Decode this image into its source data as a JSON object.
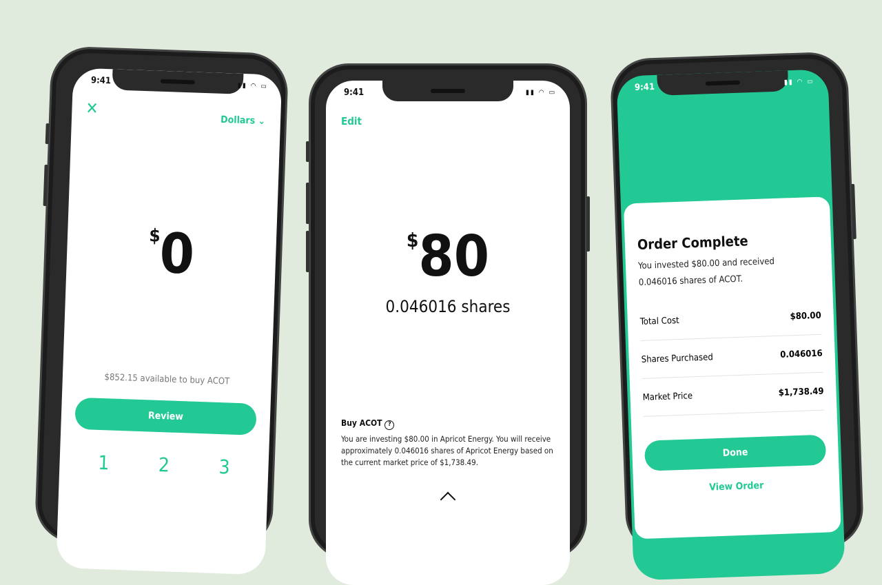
{
  "colors": {
    "accent": "#23c995",
    "background": "#e1ebdd"
  },
  "status_time": "9:41",
  "phone1": {
    "close_icon": "close-icon",
    "currency_selector": "Dollars",
    "currency_symbol": "$",
    "amount": "0",
    "available": "$852.15 available to buy ACOT",
    "review_label": "Review",
    "keypad": [
      "1",
      "2",
      "3"
    ]
  },
  "phone2": {
    "edit_label": "Edit",
    "currency_symbol": "$",
    "amount": "80",
    "shares": "0.046016 shares",
    "buy_title": "Buy ACOT",
    "help_icon": "question-circle-icon",
    "description": "You are investing $80.00 in Apricot Energy. You will receive approximately 0.046016 shares of Apricot Energy based on the current market price of $1,738.49."
  },
  "phone3": {
    "title": "Order Complete",
    "message": "You invested $80.00 and received 0.046016 shares of ACOT.",
    "rows": [
      {
        "label": "Total Cost",
        "value": "$80.00"
      },
      {
        "label": "Shares Purchased",
        "value": "0.046016"
      },
      {
        "label": "Market Price",
        "value": "$1,738.49"
      }
    ],
    "done_label": "Done",
    "view_order_label": "View Order"
  }
}
